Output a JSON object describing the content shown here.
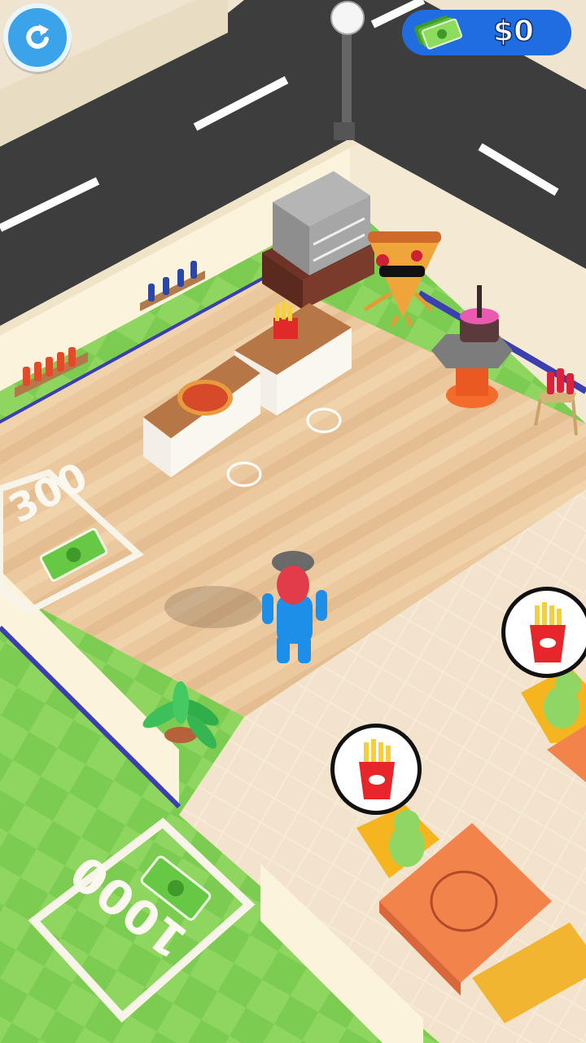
{
  "hud": {
    "currency_amount": "$0",
    "refresh_icon": "refresh-icon",
    "cash_icon": "cash-stack-icon"
  },
  "unlock_zones": [
    {
      "price": "300"
    },
    {
      "price": "1000"
    }
  ],
  "orders": [
    {
      "item": "fries-icon"
    },
    {
      "item": "fries-icon"
    }
  ],
  "colors": {
    "money_pill": "#1f6de0",
    "refresh_button": "#3aa3ea",
    "grass": "#7ac94e",
    "floor_wood": "#e9c79d",
    "player": "#1e8fe8"
  }
}
